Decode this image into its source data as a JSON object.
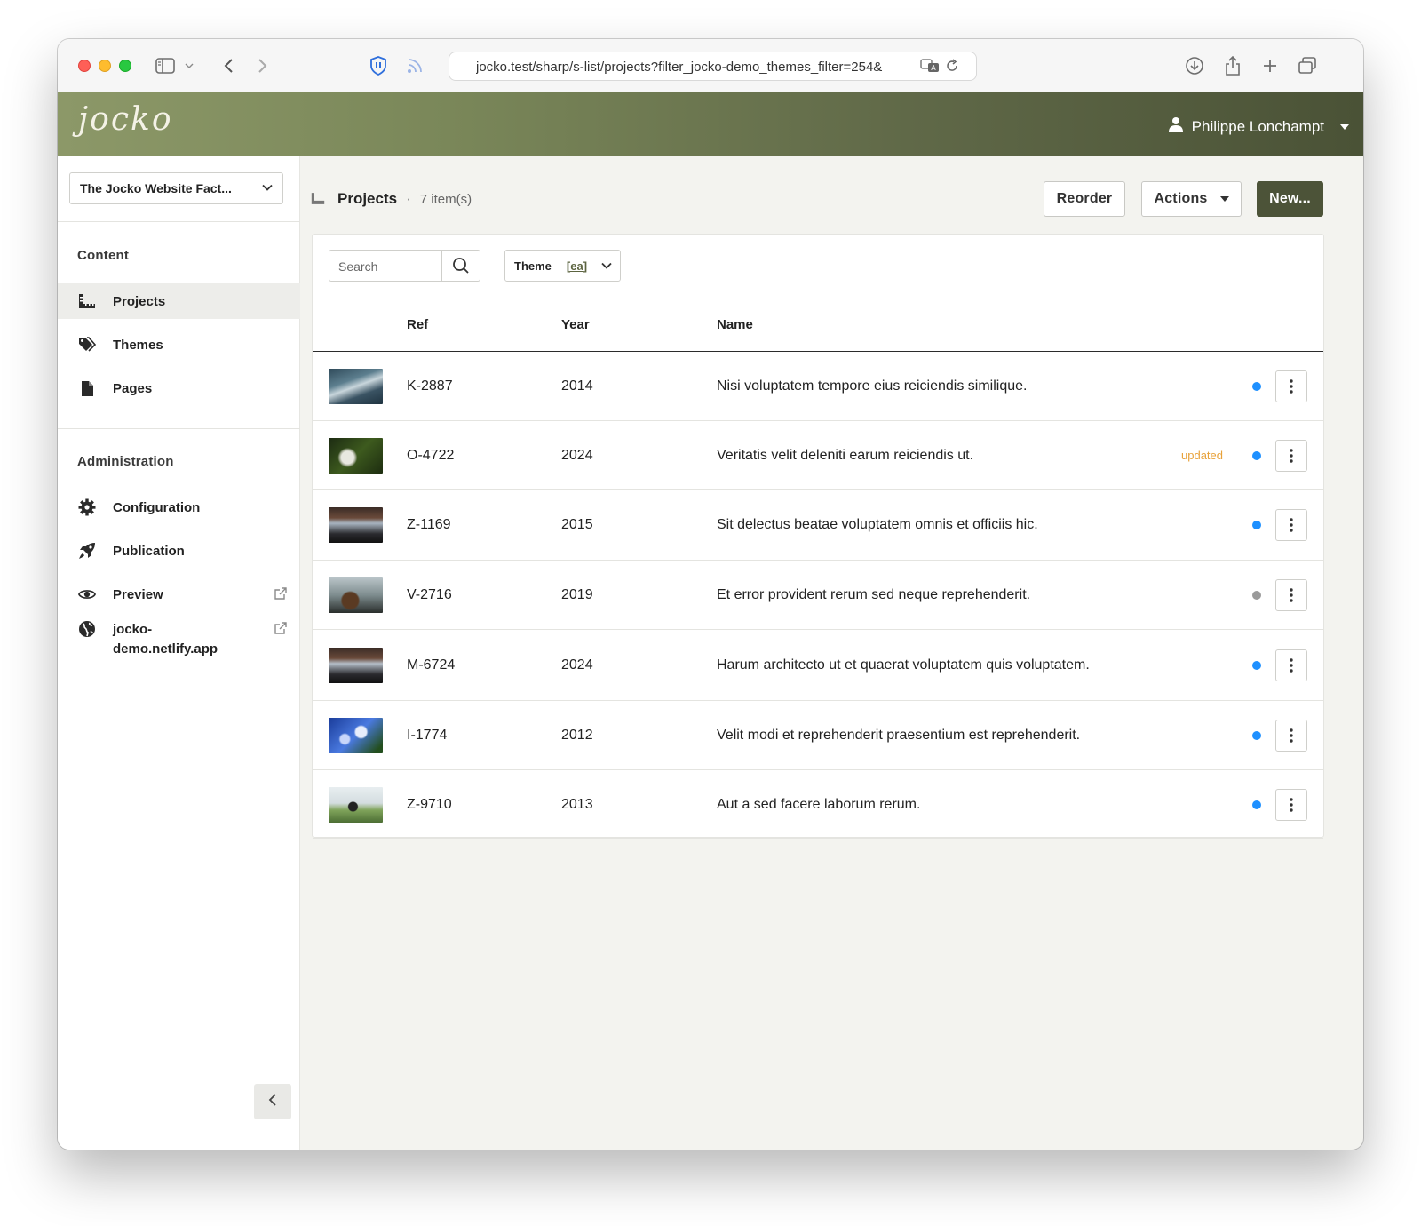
{
  "browser": {
    "url": "jocko.test/sharp/s-list/projects?filter_jocko-demo_themes_filter=254&"
  },
  "app": {
    "logo": "jocko",
    "user_name": "Philippe Lonchampt"
  },
  "sidebar": {
    "site_selector": "The Jocko Website Fact...",
    "sections": [
      {
        "heading": "Content",
        "items": [
          {
            "label": "Projects",
            "icon": "ruler-icon",
            "active": true
          },
          {
            "label": "Themes",
            "icon": "tags-icon"
          },
          {
            "label": "Pages",
            "icon": "file-icon"
          }
        ]
      },
      {
        "heading": "Administration",
        "items": [
          {
            "label": "Configuration",
            "icon": "gear-icon"
          },
          {
            "label": "Publication",
            "icon": "rocket-icon"
          },
          {
            "label": "Preview",
            "icon": "eye-icon",
            "external": true
          },
          {
            "label": "jocko-demo.netlify.app",
            "label_line1": "jocko-",
            "label_line2": "demo.netlify.app",
            "icon": "globe-icon",
            "external": true
          }
        ]
      }
    ]
  },
  "main": {
    "title": "Projects",
    "count": "7 item(s)",
    "buttons": {
      "reorder": "Reorder",
      "actions": "Actions",
      "new": "New..."
    },
    "search_placeholder": "Search",
    "filter": {
      "label": "Theme",
      "value": "[ea]"
    },
    "columns": {
      "ref": "Ref",
      "year": "Year",
      "name": "Name"
    },
    "rows": [
      {
        "ref": "K-2887",
        "year": "2014",
        "name": "Nisi voluptatem tempore eius reiciendis similique.",
        "badge": "",
        "state_color": "#1e90ff"
      },
      {
        "ref": "O-4722",
        "year": "2024",
        "name": "Veritatis velit deleniti earum reiciendis ut.",
        "badge": "updated",
        "state_color": "#1e90ff"
      },
      {
        "ref": "Z-1169",
        "year": "2015",
        "name": "Sit delectus beatae voluptatem omnis et officiis hic.",
        "badge": "",
        "state_color": "#1e90ff"
      },
      {
        "ref": "V-2716",
        "year": "2019",
        "name": "Et error provident rerum sed neque reprehenderit.",
        "badge": "",
        "state_color": "#9a9a9a"
      },
      {
        "ref": "M-6724",
        "year": "2024",
        "name": "Harum architecto ut et quaerat voluptatem quis voluptatem.",
        "badge": "",
        "state_color": "#1e90ff"
      },
      {
        "ref": "I-1774",
        "year": "2012",
        "name": "Velit modi et reprehenderit praesentium est reprehenderit.",
        "badge": "",
        "state_color": "#1e90ff"
      },
      {
        "ref": "Z-9710",
        "year": "2013",
        "name": "Aut a sed facere laborum rerum.",
        "badge": "",
        "state_color": "#1e90ff"
      }
    ]
  }
}
